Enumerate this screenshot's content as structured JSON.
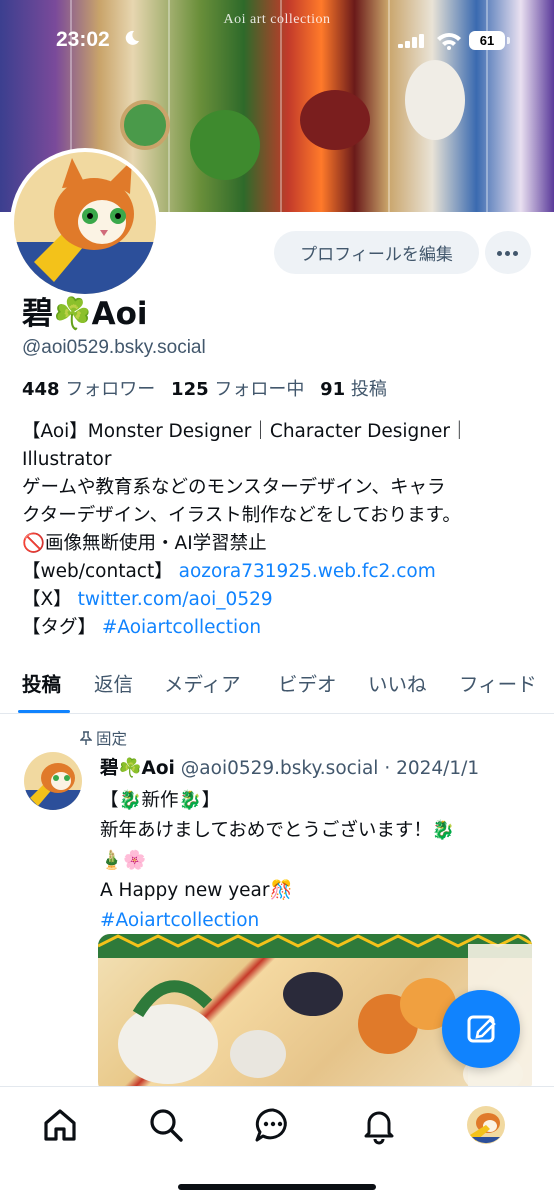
{
  "status_bar": {
    "time": "23:02",
    "battery": "61"
  },
  "banner": {
    "title": "Aoi art collection"
  },
  "profile": {
    "edit_button": "プロフィールを編集",
    "display_name": "碧☘️Aoi",
    "handle": "@aoi0529.bsky.social",
    "followers_count": "448",
    "followers_label": "フォロワー",
    "following_count": "125",
    "following_label": "フォロー中",
    "posts_count": "91",
    "posts_label": "投稿",
    "bio": {
      "line1": "【Aoi】Monster Designer｜Character Designer｜",
      "line2": "Illustrator",
      "line3": " ゲームや教育系などのモンスターデザイン、キャラ",
      "line4": "クターデザイン、イラスト制作などをしております。",
      "line5": " 🚫画像無断使用・AI学習禁止",
      "web_label": "【web/contact】 ",
      "web_link": "aozora731925.web.fc2.com",
      "x_label": "【X】 ",
      "x_link": "twitter.com/aoi_0529",
      "tag_label": "【タグ】 ",
      "tag_link": "#Aoiartcollection"
    }
  },
  "tabs": [
    "投稿",
    "返信",
    "メディア",
    "ビデオ",
    "いいね",
    "フィード"
  ],
  "post": {
    "pinned_label": "固定",
    "author_name": "碧☘️Aoi",
    "author_handle": "@aoi0529.bsky.social",
    "date": "· 2024/1/1",
    "line1": "【🐉新作🐉】",
    "line2": "新年あけましておめでとうございます！🐉",
    "line3": "🎍🌸",
    "line4": "A Happy new year🎊",
    "hashtag": "#Aoiartcollection"
  },
  "colors": {
    "accent": "#1083fe",
    "muted": "#42576c",
    "text": "#0b0f14"
  }
}
